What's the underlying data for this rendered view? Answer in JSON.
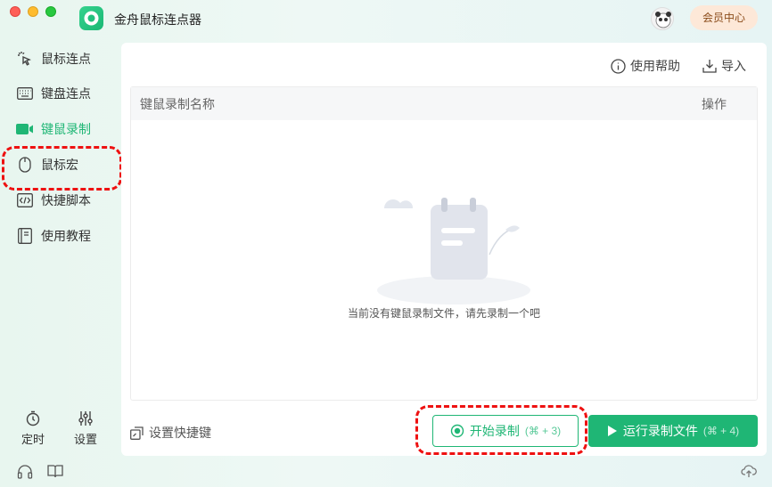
{
  "app": {
    "title": "金舟鼠标连点器",
    "member_label": "会员中心",
    "accent": "#1fb675"
  },
  "sidebar": {
    "items": [
      {
        "label": "鼠标连点",
        "icon": "mouse-click-icon"
      },
      {
        "label": "键盘连点",
        "icon": "keyboard-icon"
      },
      {
        "label": "键鼠录制",
        "icon": "video-record-icon",
        "active": true
      },
      {
        "label": "鼠标宏",
        "icon": "mouse-icon"
      },
      {
        "label": "快捷脚本",
        "icon": "code-icon"
      },
      {
        "label": "使用教程",
        "icon": "book-icon"
      }
    ],
    "bottom": [
      {
        "label": "定时",
        "icon": "timer-icon"
      },
      {
        "label": "设置",
        "icon": "sliders-icon"
      }
    ]
  },
  "toolbar": {
    "help_label": "使用帮助",
    "import_label": "导入"
  },
  "table": {
    "columns": [
      "键鼠录制名称",
      "操作"
    ],
    "rows": [],
    "empty_text": "当前没有键鼠录制文件，请先录制一个吧"
  },
  "footer": {
    "shortcut_label": "设置快捷键",
    "start_label": "开始录制",
    "start_shortcut": "(⌘ + 3)",
    "run_label": "运行录制文件",
    "run_shortcut": "(⌘ + 4)"
  }
}
